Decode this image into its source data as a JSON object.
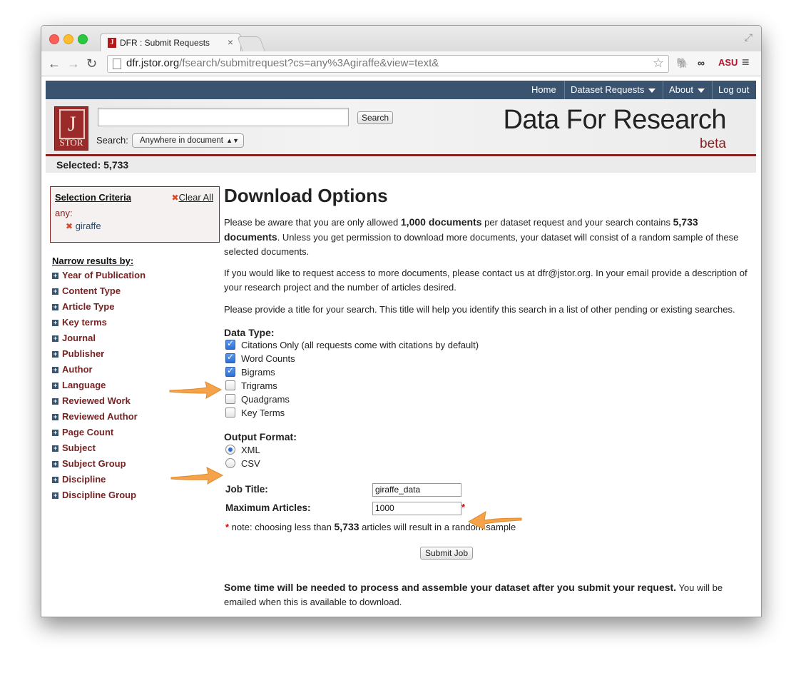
{
  "browser": {
    "tab_title": "DFR : Submit Requests",
    "tab_favicon": "J",
    "url_host": "dfr.jstor.org",
    "url_path": "/fsearch/submitrequest?cs=any%3Agiraffe&view=text&",
    "back_icon": "←",
    "forward_icon": "→",
    "reload_icon": "↻",
    "star_icon": "☆",
    "menu_icon": "≡",
    "ext_asu_label": "ASU"
  },
  "nav": {
    "home": "Home",
    "dataset_requests": "Dataset Requests",
    "about": "About",
    "logout": "Log out"
  },
  "header": {
    "logo_letter": "J",
    "logo_text": "STOR",
    "search_button": "Search",
    "search_label": "Search:",
    "search_scope": "Anywhere in document",
    "brand": "Data For Research",
    "beta": "beta"
  },
  "selected": "Selected: 5,733",
  "criteria": {
    "title": "Selection Criteria",
    "clear_all": "Clear All",
    "scope": "any:",
    "term": "giraffe"
  },
  "narrow": {
    "title": "Narrow results by:",
    "facets": [
      "Year of Publication",
      "Content Type",
      "Article Type",
      "Key terms",
      "Journal",
      "Publisher",
      "Author",
      "Language",
      "Reviewed Work",
      "Reviewed Author",
      "Page Count",
      "Subject",
      "Subject Group",
      "Discipline",
      "Discipline Group"
    ]
  },
  "main": {
    "heading": "Download Options",
    "p1_a": "Please be aware that you are only allowed ",
    "p1_b": "1,000 documents",
    "p1_c": " per dataset request and your search contains ",
    "p1_d": "5,733 documents",
    "p1_e": ". Unless you get permission to download more documents, your dataset will consist of a random sample of these selected documents.",
    "p2": "If you would like to request access to more documents, please contact us at dfr@jstor.org. In your email provide a description of your research project and the number of articles desired.",
    "p3": "Please provide a title for your search. This title will help you identify this search in a list of other pending or existing searches.",
    "data_type_label": "Data Type:",
    "data_types": [
      {
        "label": "Citations Only (all requests come with citations by default)",
        "checked": true
      },
      {
        "label": "Word Counts",
        "checked": true
      },
      {
        "label": "Bigrams",
        "checked": true
      },
      {
        "label": "Trigrams",
        "checked": false
      },
      {
        "label": "Quadgrams",
        "checked": false
      },
      {
        "label": "Key Terms",
        "checked": false
      }
    ],
    "output_format_label": "Output Format:",
    "formats": [
      {
        "label": "XML",
        "selected": true
      },
      {
        "label": "CSV",
        "selected": false
      }
    ],
    "job_title_label": "Job Title:",
    "job_title_value": "giraffe_data",
    "max_articles_label": "Maximum Articles:",
    "max_articles_value": "1000",
    "required_mark": "*",
    "note_a": " note: choosing less than ",
    "note_b": "5,733",
    "note_c": " articles will result in a random sample",
    "submit": "Submit Job",
    "footer_bold": "Some time will be needed to process and assemble your dataset after you submit your request.",
    "footer_rest": " You will be emailed when this is available to download."
  },
  "colors": {
    "nav_bg": "#3a536e",
    "accent_red": "#8a1e1e",
    "facet_text": "#7a2222",
    "arrow_orange": "#f5a24a"
  }
}
